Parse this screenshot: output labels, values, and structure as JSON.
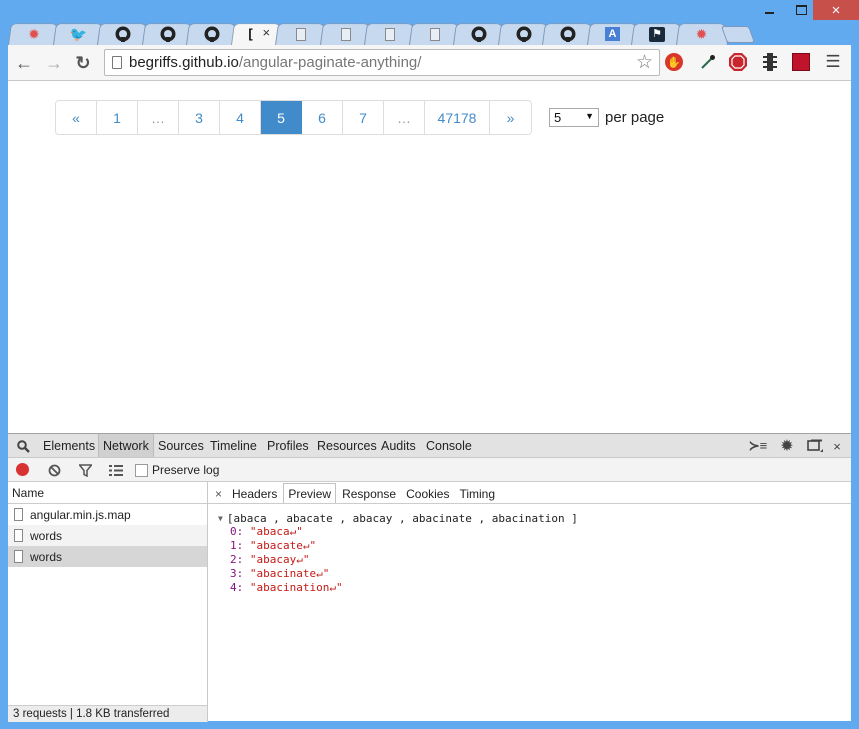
{
  "window": {
    "controls": {
      "minimize": "minimize",
      "maximize": "maximize",
      "close": "×"
    }
  },
  "tabs": [
    {
      "icon": "gear-red-icon",
      "glyph": "✹",
      "color": "#e05050",
      "active": false
    },
    {
      "icon": "twitter-icon",
      "glyph": "🐦",
      "color": "#3a9fe0",
      "active": false
    },
    {
      "icon": "github-icon",
      "glyph": "●",
      "color": "#222222",
      "active": false
    },
    {
      "icon": "github-icon",
      "glyph": "●",
      "color": "#222222",
      "active": false
    },
    {
      "icon": "github-icon",
      "glyph": "●",
      "color": "#222222",
      "active": false
    },
    {
      "icon": "loading-icon",
      "glyph": "[",
      "color": "#111111",
      "active": true,
      "close": "×"
    },
    {
      "icon": "page-icon",
      "glyph": "",
      "color": "#888888",
      "active": false
    },
    {
      "icon": "page-icon",
      "glyph": "",
      "color": "#888888",
      "active": false
    },
    {
      "icon": "page-icon",
      "glyph": "",
      "color": "#888888",
      "active": false
    },
    {
      "icon": "page-icon",
      "glyph": "",
      "color": "#888888",
      "active": false
    },
    {
      "icon": "github-icon",
      "glyph": "●",
      "color": "#222222",
      "active": false
    },
    {
      "icon": "github-icon",
      "glyph": "●",
      "color": "#222222",
      "active": false
    },
    {
      "icon": "github-icon",
      "glyph": "●",
      "color": "#222222",
      "active": false
    },
    {
      "icon": "app-a-icon",
      "glyph": "A",
      "color": "#4a7fd6",
      "active": false
    },
    {
      "icon": "flag-icon",
      "glyph": "⚑",
      "color": "#1a2a3a",
      "active": false
    },
    {
      "icon": "gear-red-icon",
      "glyph": "✹",
      "color": "#e05050",
      "active": false
    }
  ],
  "toolbar": {
    "back": "←",
    "forward": "→",
    "reload": "↻",
    "url_host": "begriffs.github.io",
    "url_path": "/angular-paginate-anything/",
    "bookmark": "☆",
    "extensions": [
      {
        "name": "adblock-hand-icon",
        "glyph": "✋",
        "bg": "#d9352a",
        "fg": "#ffffff",
        "shape": "circle"
      },
      {
        "name": "eyedropper-icon",
        "glyph": "⁄",
        "bg": "transparent",
        "fg": "#2a6a4a",
        "shape": "none"
      },
      {
        "name": "stop-sign-icon",
        "glyph": "✋",
        "bg": "#c8262e",
        "fg": "#ffffff",
        "shape": "octagon"
      },
      {
        "name": "traffic-light-icon",
        "glyph": "≡",
        "bg": "transparent",
        "fg": "#333333",
        "shape": "none"
      },
      {
        "name": "red-extension-icon",
        "glyph": "",
        "bg": "#c0142c",
        "fg": "#ffffff",
        "shape": "square"
      },
      {
        "name": "menu-icon",
        "glyph": "☰",
        "bg": "transparent",
        "fg": "#444444",
        "shape": "none"
      }
    ]
  },
  "pagination": {
    "items": [
      {
        "label": "«",
        "type": "prev",
        "width": 41
      },
      {
        "label": "1",
        "type": "page",
        "width": 41
      },
      {
        "label": "…",
        "type": "ellipsis",
        "width": 41
      },
      {
        "label": "3",
        "type": "page",
        "width": 41
      },
      {
        "label": "4",
        "type": "page",
        "width": 41
      },
      {
        "label": "5",
        "type": "active",
        "width": 41
      },
      {
        "label": "6",
        "type": "page",
        "width": 41
      },
      {
        "label": "7",
        "type": "page",
        "width": 41
      },
      {
        "label": "…",
        "type": "ellipsis",
        "width": 41
      },
      {
        "label": "47178",
        "type": "page",
        "width": 65
      },
      {
        "label": "»",
        "type": "next",
        "width": 41
      }
    ],
    "per_page_value": "5",
    "per_page_label": "per page",
    "active_color": "#428bca"
  },
  "devtools": {
    "tabs": [
      "Elements",
      "Network",
      "Sources",
      "Timeline",
      "Profiles",
      "Resources",
      "Audits",
      "Console"
    ],
    "selected_tab": "Network",
    "preserve_log_label": "Preserve log",
    "preserve_log_checked": false,
    "name_header": "Name",
    "requests": [
      {
        "name": "angular.min.js.map",
        "selected": false
      },
      {
        "name": "words",
        "selected": false
      },
      {
        "name": "words",
        "selected": true
      }
    ],
    "summary": "3 requests | 1.8 KB transferred",
    "detail_tabs": [
      "Headers",
      "Preview",
      "Response",
      "Cookies",
      "Timing"
    ],
    "selected_detail_tab": "Preview",
    "preview": {
      "summary": "[abaca , abacate , abacay , abacinate , abacination ]",
      "items": [
        {
          "key": "0",
          "value": "\"abaca↵\""
        },
        {
          "key": "1",
          "value": "\"abacate↵\""
        },
        {
          "key": "2",
          "value": "\"abacay↵\""
        },
        {
          "key": "3",
          "value": "\"abacinate↵\""
        },
        {
          "key": "4",
          "value": "\"abacination↵\""
        }
      ]
    }
  }
}
